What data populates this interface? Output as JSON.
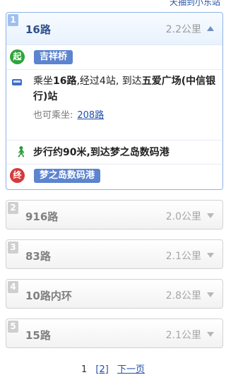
{
  "top_link": "天抽到小东站",
  "routes": [
    {
      "num": "1",
      "name": "16路",
      "dist": "2.2公里"
    },
    {
      "num": "2",
      "name": "916路",
      "dist": "2.0公里"
    },
    {
      "num": "3",
      "name": "83路",
      "dist": "2.1公里"
    },
    {
      "num": "4",
      "name": "10路内环",
      "dist": "2.8公里"
    },
    {
      "num": "5",
      "name": "15路",
      "dist": "2.1公里"
    }
  ],
  "detail": {
    "start_icon": "起",
    "start_stop": "吉祥桥",
    "bus_step": {
      "pre": "乘坐",
      "line": "16路",
      "mid": ",经过4站, 到达",
      "dest": "五爱广场(中信银行)站"
    },
    "also_label": "也可乘坐:",
    "also_link": "208路",
    "walk_step": {
      "pre": "步行约90米,到达",
      "dest": "梦之岛数码港"
    },
    "end_icon": "终",
    "end_stop": "梦之岛数码港"
  },
  "pager": {
    "current": "1",
    "page2": "[2]",
    "next": "下一页"
  },
  "colors": {
    "accent": "#5c84cf",
    "start_green": "#2fa53a",
    "end_red": "#d43b3b"
  }
}
